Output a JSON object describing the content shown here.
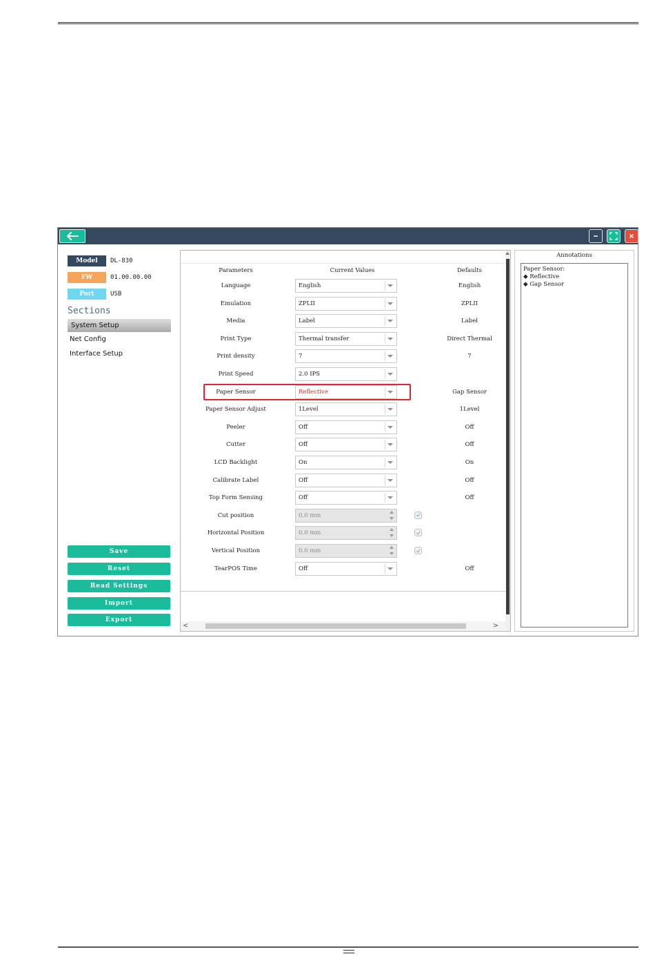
{
  "side": {
    "model_tag": "Model",
    "model_value": "DL-830",
    "fw_tag": "FW",
    "fw_value": "01.00.00.00",
    "port_tag": "Port",
    "port_value": "USB",
    "sections_title": "Sections",
    "sections": [
      "System Setup",
      "Net Config",
      "Interface Setup"
    ],
    "buttons": [
      "Save",
      "Reset",
      "Read Settings",
      "Import",
      "Export"
    ]
  },
  "table": {
    "headers": {
      "parameters": "Parameters",
      "current": "Current Values",
      "defaults": "Defaults"
    },
    "rows": [
      {
        "label": "Language",
        "value": "English",
        "default": "English"
      },
      {
        "label": "Emulation",
        "value": "ZPLII",
        "default": "ZPLII"
      },
      {
        "label": "Media",
        "value": "Label",
        "default": "Label"
      },
      {
        "label": "Print Type",
        "value": "Thermal transfer",
        "default": "Direct Thermal"
      },
      {
        "label": "Print density",
        "value": "7",
        "default": "7"
      },
      {
        "label": "Print Speed",
        "value": "2.0 IPS",
        "default": ""
      },
      {
        "label": "Paper Sensor",
        "value": "Reflective",
        "default": "Gap Sensor"
      },
      {
        "label": "Paper Sensor Adjust",
        "value": "1Level",
        "default": "1Level"
      },
      {
        "label": "Peeler",
        "value": "Off",
        "default": "Off"
      },
      {
        "label": "Cutter",
        "value": "Off",
        "default": "Off"
      },
      {
        "label": "LCD Backlight",
        "value": "On",
        "default": "On"
      },
      {
        "label": "Calibrate Label",
        "value": "Off",
        "default": "Off"
      },
      {
        "label": "Top Form Sensing",
        "value": "Off",
        "default": "Off"
      },
      {
        "label": "Cut position",
        "value": "0.0 mm",
        "default": ""
      },
      {
        "label": "Horizontal Position",
        "value": "0.0 mm",
        "default": ""
      },
      {
        "label": "Vertical Position",
        "value": "0.0 mm",
        "default": ""
      },
      {
        "label": "TearPOS Time",
        "value": "Off",
        "default": "Off"
      }
    ]
  },
  "annotations": {
    "title": "Annotations",
    "lines": [
      "Paper Sensor:",
      "◆ Reflective",
      "◆ Gap Sensor"
    ]
  },
  "colors": {
    "titlebar": "#34495e",
    "accent": "#1abc9c",
    "model_tag": "#34495e",
    "fw_tag": "#f5a55a",
    "port_tag": "#6fd8f0",
    "close": "#e74c3c",
    "highlight": "#e0262f"
  },
  "icons": {
    "back": "arrow-left-icon",
    "minimize": "minimize-icon",
    "maximize": "maximize-icon",
    "close": "close-icon"
  }
}
